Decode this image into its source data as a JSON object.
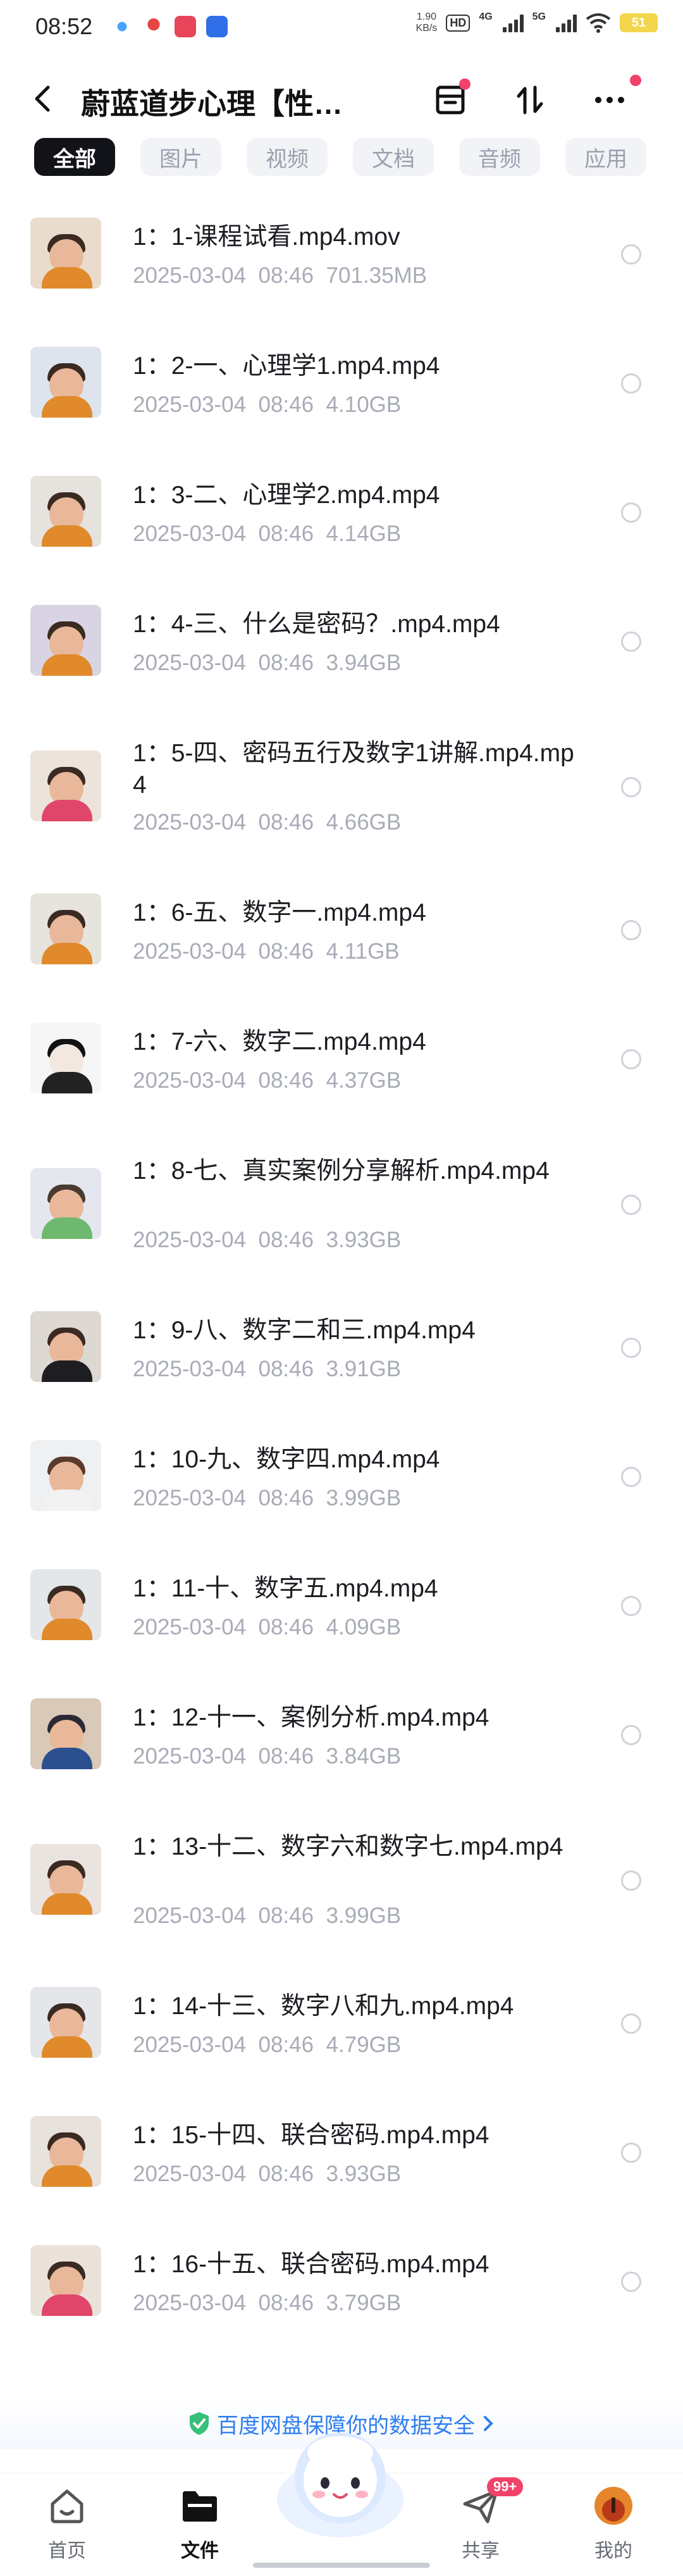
{
  "status_bar": {
    "time": "08:52",
    "net_speed_value": "1.90",
    "net_speed_unit": "KB/s",
    "hd_label": "HD",
    "sig1_label": "4G",
    "sig2_label": "5G",
    "battery": "51"
  },
  "header": {
    "title": "蔚蓝道步心理【性…"
  },
  "tabs": [
    {
      "label": "全部",
      "active": true
    },
    {
      "label": "图片",
      "active": false
    },
    {
      "label": "视频",
      "active": false
    },
    {
      "label": "文档",
      "active": false
    },
    {
      "label": "音频",
      "active": false
    },
    {
      "label": "应用",
      "active": false
    }
  ],
  "files": [
    {
      "name": "1：1-课程试看.mp4.mov",
      "date": "2025-03-04",
      "time": "08:46",
      "size": "701.35MB"
    },
    {
      "name": "1：2-一、心理学1.mp4.mp4",
      "date": "2025-03-04",
      "time": "08:46",
      "size": "4.10GB"
    },
    {
      "name": "1：3-二、心理学2.mp4.mp4",
      "date": "2025-03-04",
      "time": "08:46",
      "size": "4.14GB"
    },
    {
      "name": "1：4-三、什么是密码？.mp4.mp4",
      "date": "2025-03-04",
      "time": "08:46",
      "size": "3.94GB"
    },
    {
      "name": "1：5-四、密码五行及数字1讲解.mp4.mp4",
      "date": "2025-03-04",
      "time": "08:46",
      "size": "4.66GB"
    },
    {
      "name": "1：6-五、数字一.mp4.mp4",
      "date": "2025-03-04",
      "time": "08:46",
      "size": "4.11GB"
    },
    {
      "name": "1：7-六、数字二.mp4.mp4",
      "date": "2025-03-04",
      "time": "08:46",
      "size": "4.37GB"
    },
    {
      "name": "1：8-七、真实案例分享解析.mp4.mp4",
      "date": "2025-03-04",
      "time": "08:46",
      "size": "3.93GB"
    },
    {
      "name": "1：9-八、数字二和三.mp4.mp4",
      "date": "2025-03-04",
      "time": "08:46",
      "size": "3.91GB"
    },
    {
      "name": "1：10-九、数字四.mp4.mp4",
      "date": "2025-03-04",
      "time": "08:46",
      "size": "3.99GB"
    },
    {
      "name": "1：11-十、数字五.mp4.mp4",
      "date": "2025-03-04",
      "time": "08:46",
      "size": "4.09GB"
    },
    {
      "name": "1：12-十一、案例分析.mp4.mp4",
      "date": "2025-03-04",
      "time": "08:46",
      "size": "3.84GB"
    },
    {
      "name": "1：13-十二、数字六和数字七.mp4.mp4",
      "date": "2025-03-04",
      "time": "08:46",
      "size": "3.99GB"
    },
    {
      "name": "1：14-十三、数字八和九.mp4.mp4",
      "date": "2025-03-04",
      "time": "08:46",
      "size": "4.79GB"
    },
    {
      "name": "1：15-十四、联合密码.mp4.mp4",
      "date": "2025-03-04",
      "time": "08:46",
      "size": "3.93GB"
    },
    {
      "name": "1：16-十五、联合密码.mp4.mp4",
      "date": "2025-03-04",
      "time": "08:46",
      "size": "3.79GB"
    }
  ],
  "safety_note": "百度网盘保障你的数据安全",
  "bottom_nav": {
    "home": "首页",
    "files": "文件",
    "share": "共享",
    "share_badge": "99+",
    "mine": "我的"
  },
  "colors": {
    "accent_blue": "#2f7ef0",
    "badge_red": "#f0426a",
    "meta_gray": "#a8acb6",
    "tab_active_bg": "#111318"
  }
}
